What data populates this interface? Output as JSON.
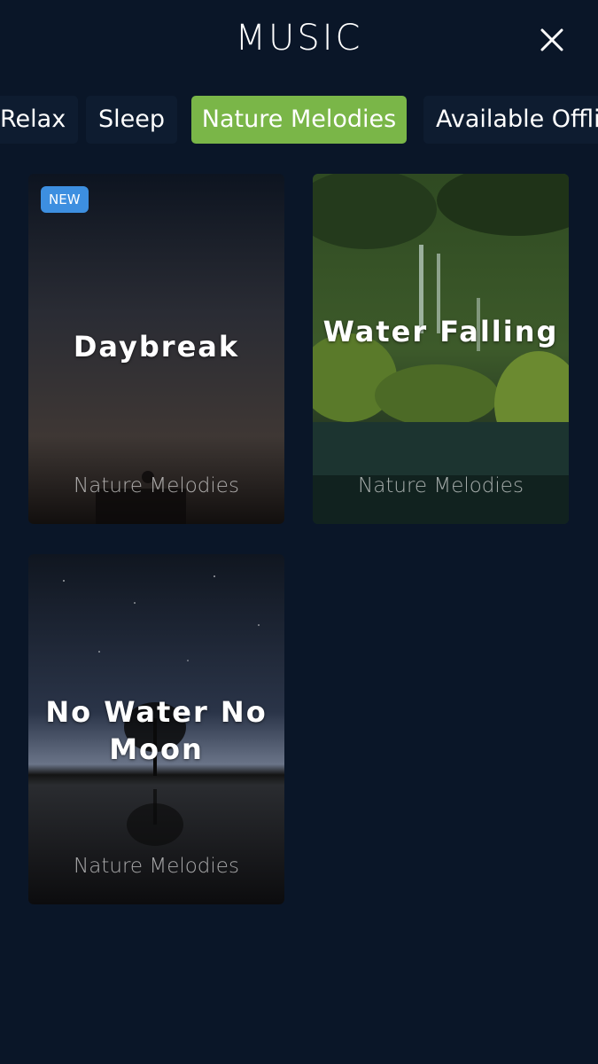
{
  "header": {
    "title": "MUSIC",
    "close_icon": "close-icon"
  },
  "tabs": [
    {
      "label": "Relax",
      "active": false
    },
    {
      "label": "Sleep",
      "active": false
    },
    {
      "label": "Nature Melodies",
      "active": true
    },
    {
      "label": "Available Offline",
      "active": false
    }
  ],
  "colors": {
    "background": "#0a1628",
    "active_tab": "#7ab648",
    "badge": "#3d8fe0"
  },
  "cards": [
    {
      "title": "Daybreak",
      "subtitle": "Nature Melodies",
      "badge": "NEW"
    },
    {
      "title": "Water Falling",
      "subtitle": "Nature Melodies"
    },
    {
      "title": "No Water No Moon",
      "subtitle": "Nature Melodies"
    }
  ]
}
